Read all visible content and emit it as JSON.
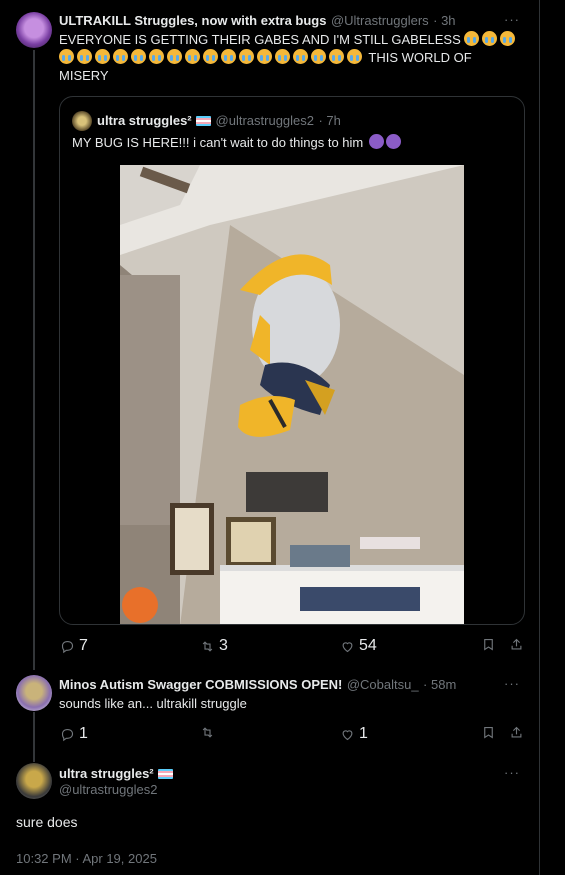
{
  "post1": {
    "display_name": "ULTRAKILL Struggles, now with extra bugs",
    "handle": "@Ultrastrugglers",
    "time": "· 3h",
    "text_line1": "EVERYONE IS GETTING THEIR GABES AND I'M STILL GABELESS",
    "text_tail": "THIS WORLD OF",
    "text_line3": "MISERY",
    "emoji_name": "loudly-crying-face",
    "quote": {
      "display_name": "ultra struggles²",
      "handle": "@ultrastruggles2",
      "time": "· 7h",
      "text": "MY BUG IS HERE!!! i can't wait to do things to him"
    },
    "replies": "7",
    "reposts": "3",
    "likes": "54"
  },
  "post2": {
    "display_name": "Minos Autism Swagger COBMISSIONS OPEN!",
    "handle": "@Cobaltsu_",
    "time": "· 58m",
    "text": "sounds like an... ultrakill struggle",
    "replies": "1",
    "reposts": "",
    "likes": "1"
  },
  "post3": {
    "display_name": "ultra struggles²",
    "handle": "@ultrastruggles2",
    "text": "sure does",
    "timestamp": "10:32 PM · Apr 19, 2025"
  },
  "more_label": "···",
  "colors": {
    "text": "#e7e9ea",
    "muted": "#71767b",
    "border": "#2f3336",
    "bg": "#000000"
  }
}
